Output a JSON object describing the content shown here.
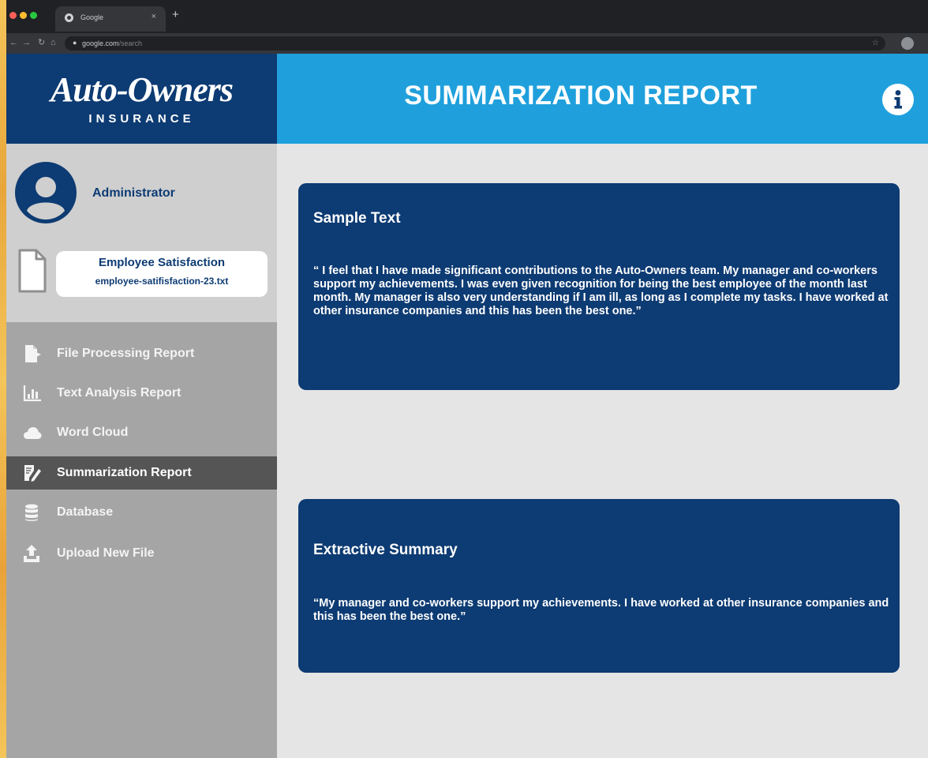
{
  "browser": {
    "tab_title": "Google",
    "tab_close": "×",
    "new_tab": "+",
    "url_domain": "google.com",
    "url_path": "/search",
    "lock_icon": "lock-icon"
  },
  "brand": {
    "logo_main": "Auto-Owners",
    "logo_sub": "INSURANCE",
    "primary_color": "#0d3b73",
    "header_color": "#1fa0dc"
  },
  "header": {
    "title": "SUMMARIZATION REPORT",
    "info_icon": "info-icon"
  },
  "user": {
    "name": "Administrator"
  },
  "file": {
    "title": "Employee Satisfaction",
    "filename": "employee-satifisfaction-23.txt"
  },
  "nav": {
    "items": [
      {
        "label": "File Processing Report",
        "icon": "file-processing-icon"
      },
      {
        "label": "Text Analysis Report",
        "icon": "bar-chart-icon"
      },
      {
        "label": "Word Cloud",
        "icon": "cloud-icon"
      },
      {
        "label": "Summarization Report",
        "icon": "edit-document-icon",
        "active": true
      },
      {
        "label": "Database",
        "icon": "database-icon"
      },
      {
        "label": "Upload New File",
        "icon": "upload-icon"
      }
    ]
  },
  "sample": {
    "title": "Sample Text",
    "text": "“ I feel that I have made significant contributions to the Auto-Owners team. My manager and co-workers support my achievements. I was even given recognition for being the best employee of the month last month. My manager is also very understanding if I am ill, as long as I complete my tasks. I have worked at other insurance companies and this has been the best one.”"
  },
  "summary": {
    "title": "Extractive Summary",
    "text": "“My manager and co-workers support my achievements. I have worked at other insurance companies and this has been the best one.”"
  }
}
